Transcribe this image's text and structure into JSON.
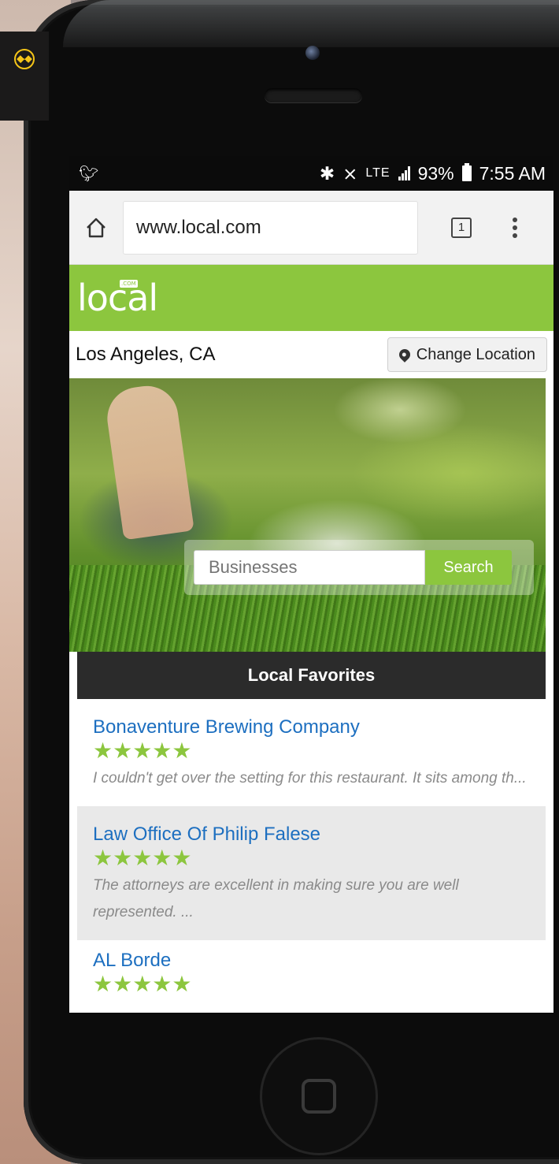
{
  "status_bar": {
    "left_icon": "twitter-icon",
    "battery_percent": "93%",
    "lte_label": "LTE",
    "time": "7:55 AM"
  },
  "browser": {
    "url": "www.local.com",
    "tab_count": "1"
  },
  "brand": {
    "logo_text": "local",
    "logo_badge": ".COM",
    "color": "#8cc63e"
  },
  "location": {
    "city": "Los Angeles, CA",
    "change_label": "Change Location"
  },
  "search": {
    "placeholder": "Businesses",
    "button_label": "Search"
  },
  "favorites": {
    "header": "Local Favorites",
    "items": [
      {
        "name": "Bonaventure Brewing Company",
        "rating": 5,
        "review": "I couldn't get over the setting for this restaurant. It sits among th..."
      },
      {
        "name": "Law Office Of Philip Falese",
        "rating": 5,
        "review": "The attorneys are excellent in making sure you are well represented. ..."
      },
      {
        "name": "AL Borde",
        "rating": 5,
        "review": ""
      }
    ]
  }
}
